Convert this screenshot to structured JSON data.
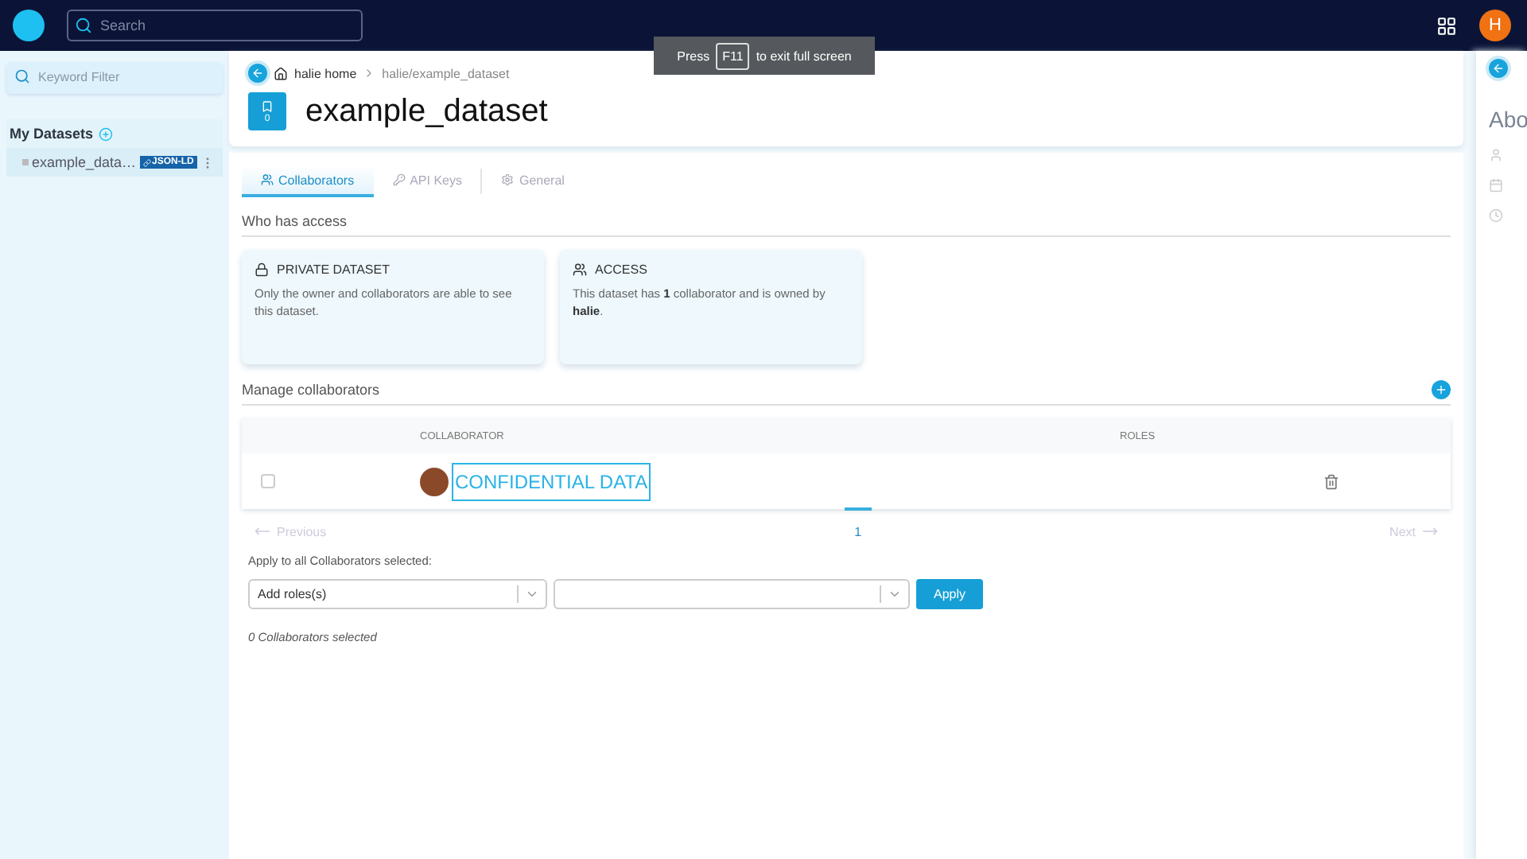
{
  "topbar": {
    "search": {
      "placeholder": "Search"
    },
    "avatar": "H"
  },
  "fullscreen_notice": {
    "before": "Press",
    "key": "F11",
    "after": "to exit full screen"
  },
  "sidebar": {
    "filter": {
      "placeholder": "Keyword Filter"
    },
    "section": "My Datasets",
    "items": [
      {
        "name": "example_data…",
        "badge": "JSON-LD",
        "selected": true
      }
    ]
  },
  "breadcrumb": [
    {
      "label": "halie home",
      "kind": "home"
    },
    {
      "label": "halie/example_dataset",
      "kind": "path"
    }
  ],
  "dataset": {
    "title": "example_dataset",
    "bookmarks": "0"
  },
  "tabs": [
    {
      "label": "Collaborators",
      "selected": true
    },
    {
      "label": "API Keys",
      "selected": false
    },
    {
      "label": "General",
      "selected": false
    }
  ],
  "access_heading": "Who has access",
  "cards": [
    {
      "kind": "lock",
      "title": "PRIVATE DATASET",
      "text": "Only the owner and collaborators are able to see this dataset."
    },
    {
      "kind": "users",
      "title": "ACCESS",
      "text": "This dataset has **1** collaborator and is owned by **halie**."
    }
  ],
  "manage_heading": "Manage collaborators",
  "table": {
    "columns": [
      "COLLABORATOR",
      "ROLES"
    ],
    "rows": [
      {
        "name": "CONFIDENTIAL DATA",
        "checked": false
      }
    ]
  },
  "pagination": {
    "previous": {
      "label": "Previous",
      "disabled": true
    },
    "pages": [
      {
        "label": "1",
        "selected": true
      }
    ],
    "next": {
      "label": "Next",
      "disabled": true
    }
  },
  "bulk": {
    "label": "Apply to all Collaborators selected:",
    "roles_placeholder": "Add roles(s)",
    "apply": "Apply",
    "status": "0 Collaborators selected"
  },
  "right_panel": {
    "title": "Abo"
  }
}
